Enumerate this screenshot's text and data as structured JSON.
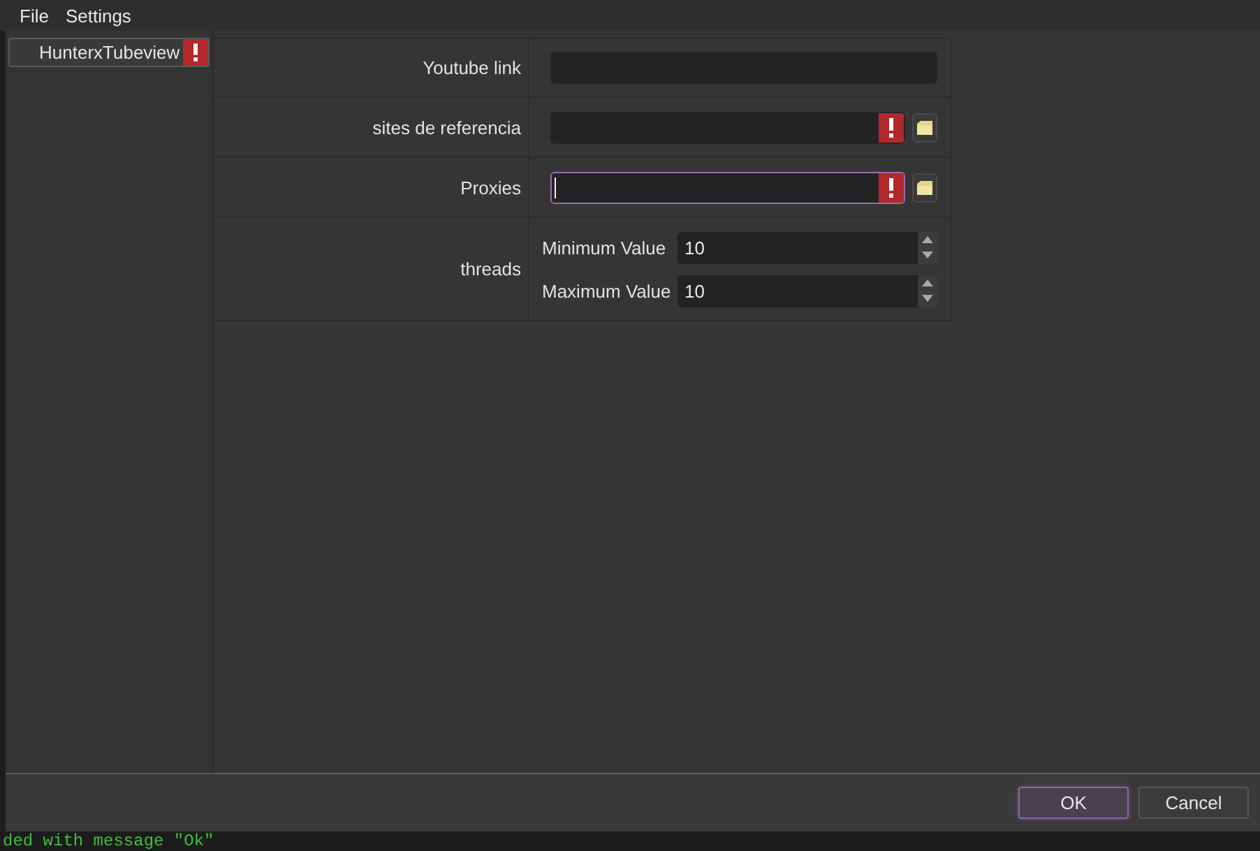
{
  "menu": [
    {
      "label": "File"
    },
    {
      "label": "Settings"
    }
  ],
  "sidebar": {
    "items": [
      {
        "label": "HunterxTubeview",
        "selected": true,
        "warning": true
      }
    ]
  },
  "form": {
    "rows": [
      {
        "kind": "text",
        "label": "Youtube link",
        "warning": false,
        "browse": false,
        "focused": false
      },
      {
        "kind": "text",
        "label": "sites de referencia",
        "warning": true,
        "browse": true,
        "focused": false
      },
      {
        "kind": "text",
        "label": "Proxies",
        "warning": true,
        "browse": true,
        "focused": true
      },
      {
        "kind": "range",
        "label": "threads",
        "fields": [
          {
            "label": "Minimum Value",
            "value": "10"
          },
          {
            "label": "Maximum Value",
            "value": "10"
          }
        ]
      }
    ]
  },
  "buttons": [
    {
      "label": "OK",
      "default": true
    },
    {
      "label": "Cancel",
      "default": false
    }
  ],
  "background_window": {
    "text": "ded with message \"Ok\""
  }
}
